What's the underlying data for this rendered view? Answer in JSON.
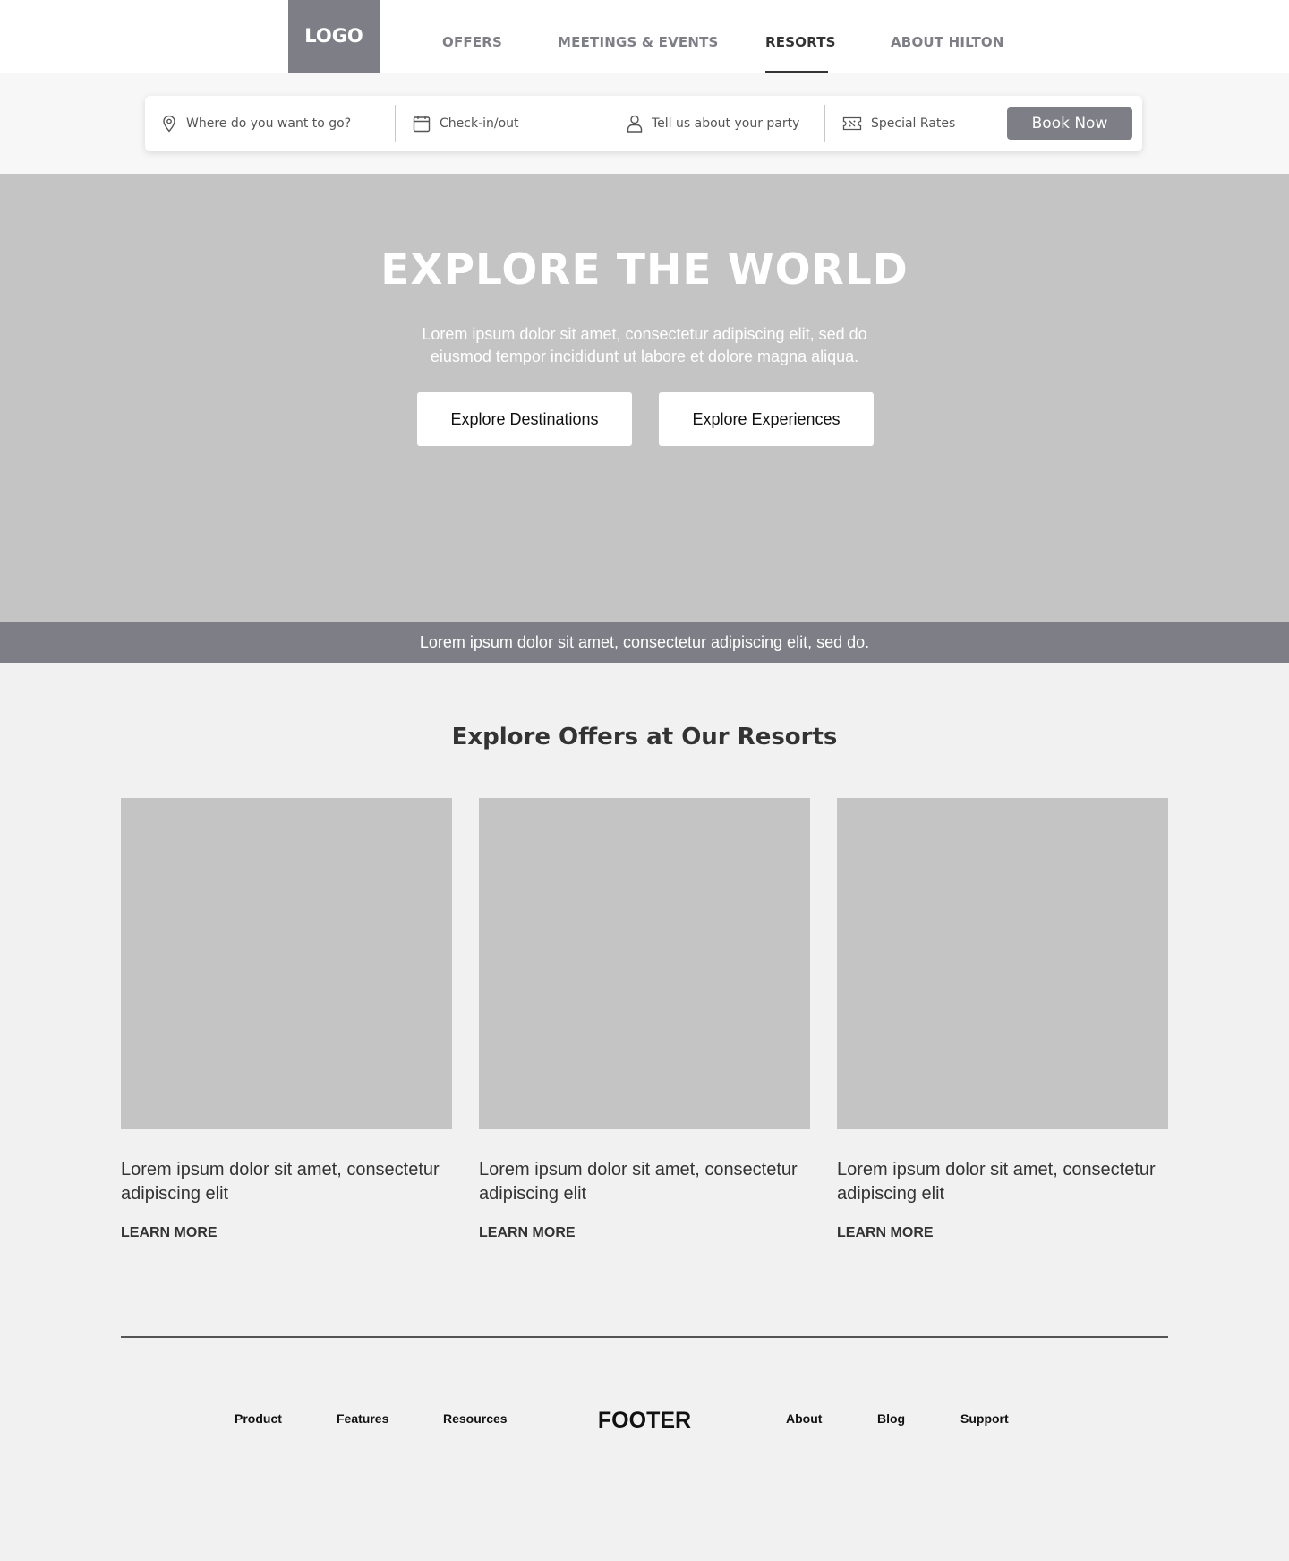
{
  "header": {
    "logo": "LOGO",
    "nav": [
      {
        "label": "OFFERS",
        "active": false
      },
      {
        "label": "MEETINGS & EVENTS",
        "active": false
      },
      {
        "label": "RESORTS",
        "active": true
      },
      {
        "label": "ABOUT HILTON",
        "active": false
      }
    ]
  },
  "booking": {
    "destination_placeholder": "Where do you want to go?",
    "dates_placeholder": "Check-in/out",
    "party_placeholder": "Tell us about your party",
    "rates_label": "Special Rates",
    "book_label": "Book Now",
    "icons": [
      "location-pin-icon",
      "calendar-icon",
      "person-icon",
      "ticket-icon"
    ]
  },
  "hero": {
    "title": "EXPLORE THE WORLD",
    "subtitle": "Lorem ipsum dolor sit amet, consectetur adipiscing elit, sed do eiusmod tempor incididunt ut labore et dolore magna aliqua.",
    "buttons": [
      "Explore Destinations",
      "Explore Experiences"
    ]
  },
  "announcement": "Lorem ipsum dolor sit amet, consectetur adipiscing elit, sed do.",
  "offers": {
    "title": "Explore Offers at Our Resorts",
    "cards": [
      {
        "text": "Lorem ipsum dolor sit amet, consectetur adipiscing elit",
        "link": "LEARN MORE"
      },
      {
        "text": "Lorem ipsum dolor sit amet, consectetur adipiscing elit",
        "link": "LEARN MORE"
      },
      {
        "text": "Lorem ipsum dolor sit amet, consectetur adipiscing elit",
        "link": "LEARN MORE"
      }
    ]
  },
  "footer": {
    "title": "FOOTER",
    "left_links": [
      "Product",
      "Features",
      "Resources"
    ],
    "right_links": [
      "About",
      "Blog",
      "Support"
    ]
  },
  "colors": {
    "accent_gray": "#7e7e86",
    "placeholder_gray": "#c4c4c4",
    "page_bg": "#f1f1f1"
  }
}
